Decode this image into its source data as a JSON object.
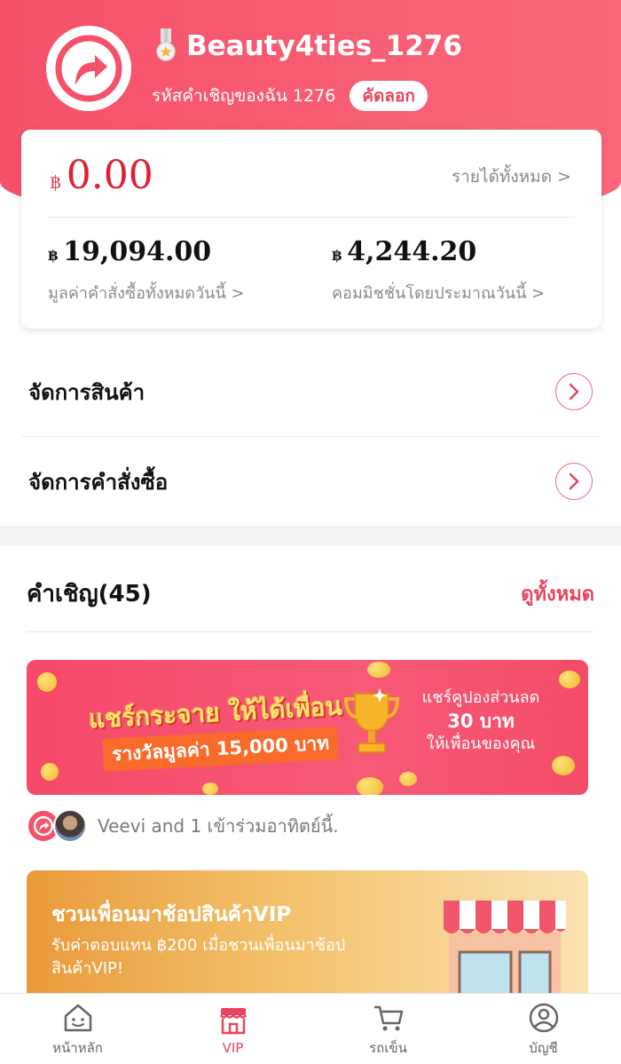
{
  "profile": {
    "username": "Beauty4ties_1276",
    "invite_code_label": "รหัสคำเชิญของฉัน 1276",
    "copy_label": "คัดลอก"
  },
  "earnings": {
    "currency": "฿",
    "total": "0.00",
    "total_link": "รายได้ทั้งหมด >",
    "order_value": "19,094.00",
    "order_value_label": "มูลค่าคำสั่งซื้อทั้งหมดวันนี้ >",
    "commission": "4,244.20",
    "commission_label": "คอมมิชชั่นโดยประมาณวันนี้ >"
  },
  "menu": {
    "manage_products": "จัดการสินค้า",
    "manage_orders": "จัดการคำสั่งซื้อ"
  },
  "invites": {
    "title": "คำเชิญ(45)",
    "see_all": "ดูทั้งหมด",
    "joined_text": "Veevi and 1 เข้าร่วมอาทิตย์นี้."
  },
  "share_banner": {
    "headline": "แชร์กระจาย ให้ได้เพื่อน",
    "prize": "รางวัลมูลค่า 15,000 บาท",
    "coupon_line1": "แชร์คูปองส่วนลด",
    "coupon_amount": "30 บาท",
    "coupon_line3": "ให้เพื่อนของคุณ"
  },
  "vip_banner": {
    "title": "ชวนเพื่อนมาช้อปสินค้าVIP",
    "description": "รับค่าตอบแทน ฿200 เมื่อชวนเพื่อนมาช้อปสินค้าVIP!"
  },
  "tabs": [
    {
      "label": "หน้าหลัก",
      "icon": "home-icon"
    },
    {
      "label": "VIP",
      "icon": "store-icon"
    },
    {
      "label": "รถเข็น",
      "icon": "cart-icon"
    },
    {
      "label": "บัญชี",
      "icon": "account-icon"
    }
  ],
  "colors": {
    "brand": "#f5516a",
    "accent_text": "#e8455f",
    "total_amount": "#e02030"
  }
}
